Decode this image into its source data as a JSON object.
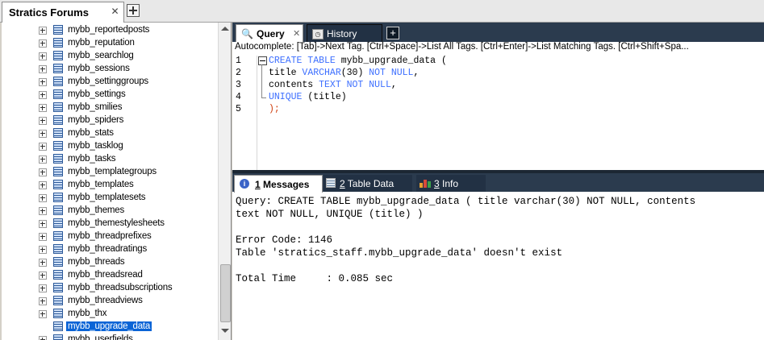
{
  "connection_tab": {
    "label": "Stratics Forums",
    "close_glyph": "✕",
    "add_glyph": "+"
  },
  "tree": {
    "items": [
      {
        "label": "mybb_reportedposts"
      },
      {
        "label": "mybb_reputation"
      },
      {
        "label": "mybb_searchlog"
      },
      {
        "label": "mybb_sessions"
      },
      {
        "label": "mybb_settinggroups"
      },
      {
        "label": "mybb_settings"
      },
      {
        "label": "mybb_smilies"
      },
      {
        "label": "mybb_spiders"
      },
      {
        "label": "mybb_stats"
      },
      {
        "label": "mybb_tasklog"
      },
      {
        "label": "mybb_tasks"
      },
      {
        "label": "mybb_templategroups"
      },
      {
        "label": "mybb_templates"
      },
      {
        "label": "mybb_templatesets"
      },
      {
        "label": "mybb_themes"
      },
      {
        "label": "mybb_themestylesheets"
      },
      {
        "label": "mybb_threadprefixes"
      },
      {
        "label": "mybb_threadratings"
      },
      {
        "label": "mybb_threads"
      },
      {
        "label": "mybb_threadsread"
      },
      {
        "label": "mybb_threadsubscriptions"
      },
      {
        "label": "mybb_threadviews"
      },
      {
        "label": "mybb_thx"
      },
      {
        "label": "mybb_upgrade_data",
        "selected": true
      },
      {
        "label": "mybb_userfields"
      }
    ]
  },
  "editor": {
    "tabs": {
      "query": "Query",
      "history": "History",
      "query_close": "✕",
      "add": "+"
    },
    "autocomplete": "Autocomplete: [Tab]->Next Tag. [Ctrl+Space]->List All Tags. [Ctrl+Enter]->List Matching Tags. [Ctrl+Shift+Spa...",
    "line_numbers": [
      "1",
      "2",
      "3",
      "4",
      "5"
    ],
    "code": {
      "l1_kw": "CREATE TABLE",
      "l1_rest": " mybb_upgrade_data (",
      "l2_a": "title ",
      "l2_kw": "VARCHAR",
      "l2_b": "(30) ",
      "l2_kw2": "NOT NULL",
      "l2_c": ",",
      "l3_a": "contents ",
      "l3_kw": "TEXT NOT NULL",
      "l3_b": ",",
      "l4_kw": "UNIQUE",
      "l4_rest": " (title)",
      "l5": ");"
    }
  },
  "results": {
    "tabs": {
      "messages_num": "1",
      "messages_label": " Messages",
      "tabledata_num": "2",
      "tabledata_label": " Table Data",
      "info_num": "3",
      "info_label": " Info"
    },
    "lines": [
      "Query: CREATE TABLE mybb_upgrade_data ( title varchar(30) NOT NULL, contents",
      "text NOT NULL, UNIQUE (title) )",
      "",
      "Error Code: 1146",
      "Table 'stratics_staff.mybb_upgrade_data' doesn't exist",
      "",
      "Total Time     : 0.085 sec"
    ]
  },
  "colors": {
    "tab_bar_dark": "#2b3b4e",
    "selection": "#0a64d6",
    "keyword": "#3d6fff"
  }
}
